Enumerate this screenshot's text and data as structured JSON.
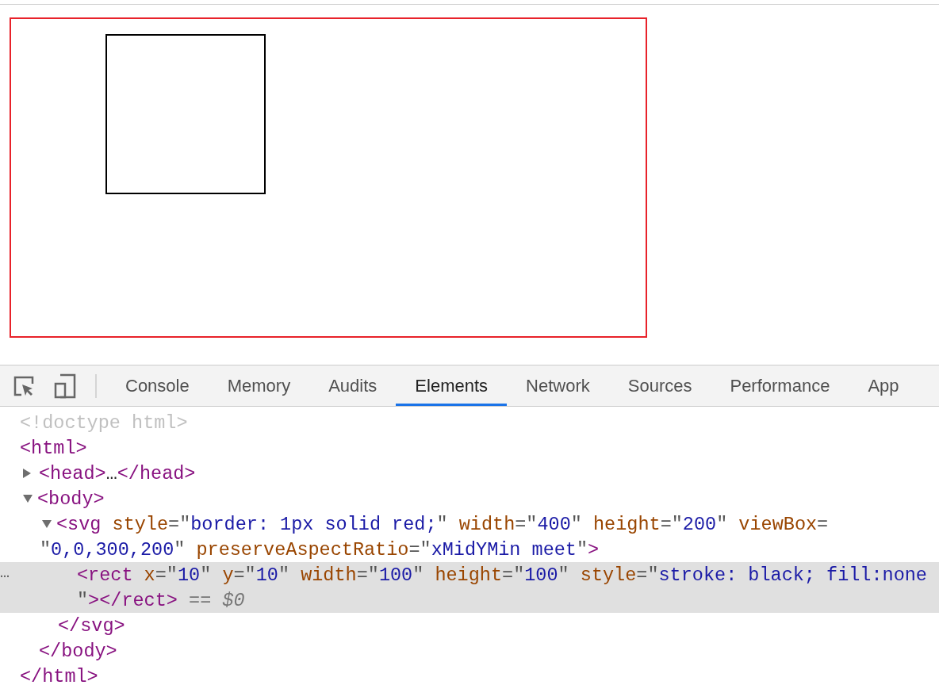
{
  "toolbar": {
    "tabs": [
      {
        "label": "Console",
        "selected": false
      },
      {
        "label": "Memory",
        "selected": false
      },
      {
        "label": "Audits",
        "selected": false
      },
      {
        "label": "Elements",
        "selected": true
      },
      {
        "label": "Network",
        "selected": false
      },
      {
        "label": "Sources",
        "selected": false
      },
      {
        "label": "Performance",
        "selected": false
      },
      {
        "label": "App",
        "selected": false
      }
    ]
  },
  "dom": [
    {
      "selected": false,
      "lines": [
        [
          {
            "kind": "doctype",
            "text": "<!doctype html>"
          }
        ]
      ]
    },
    {
      "selected": false,
      "lines": [
        [
          {
            "kind": "tag",
            "text": "<html>"
          }
        ]
      ],
      "close": [
        [
          {
            "kind": "tag",
            "text": "</html>"
          }
        ]
      ],
      "children": [
        {
          "selected": false,
          "expanded": false,
          "lines": [
            [
              {
                "kind": "tag",
                "text": "<head>"
              },
              {
                "kind": "text",
                "text": "…"
              },
              {
                "kind": "tag",
                "text": "</head>"
              }
            ]
          ]
        },
        {
          "selected": false,
          "expanded": true,
          "lines": [
            [
              {
                "kind": "tag",
                "text": "<body>"
              }
            ]
          ],
          "close": [
            [
              {
                "kind": "tag",
                "text": "</body>"
              }
            ]
          ],
          "children": [
            {
              "selected": false,
              "expanded": true,
              "lines": [
                [
                  {
                    "kind": "tag",
                    "text": "<svg"
                  },
                  {
                    "kind": "attr",
                    "text": " style"
                  },
                  {
                    "kind": "punct",
                    "text": "=\""
                  },
                  {
                    "kind": "value",
                    "text": "border: 1px solid red;"
                  },
                  {
                    "kind": "punct",
                    "text": "\""
                  },
                  {
                    "kind": "attr",
                    "text": " width"
                  },
                  {
                    "kind": "punct",
                    "text": "=\""
                  },
                  {
                    "kind": "value",
                    "text": "400"
                  },
                  {
                    "kind": "punct",
                    "text": "\""
                  },
                  {
                    "kind": "attr",
                    "text": " height"
                  },
                  {
                    "kind": "punct",
                    "text": "=\""
                  },
                  {
                    "kind": "value",
                    "text": "200"
                  },
                  {
                    "kind": "punct",
                    "text": "\""
                  },
                  {
                    "kind": "attr",
                    "text": " viewBox"
                  },
                  {
                    "kind": "punct",
                    "text": "="
                  }
                ],
                [
                  {
                    "kind": "punct",
                    "text": "\""
                  },
                  {
                    "kind": "value",
                    "text": "0,0,300,200"
                  },
                  {
                    "kind": "punct",
                    "text": "\""
                  },
                  {
                    "kind": "attr",
                    "text": " preserveAspectRatio"
                  },
                  {
                    "kind": "punct",
                    "text": "=\""
                  },
                  {
                    "kind": "value",
                    "text": "xMidYMin meet"
                  },
                  {
                    "kind": "punct",
                    "text": "\""
                  },
                  {
                    "kind": "tag",
                    "text": ">"
                  }
                ]
              ],
              "close": [
                [
                  {
                    "kind": "tag",
                    "text": "</svg>"
                  }
                ]
              ],
              "children": [
                {
                  "selected": true,
                  "gutter": "…",
                  "lines": [
                    [
                      {
                        "kind": "tag",
                        "text": "<rect"
                      },
                      {
                        "kind": "attr",
                        "text": " x"
                      },
                      {
                        "kind": "punct",
                        "text": "=\""
                      },
                      {
                        "kind": "value",
                        "text": "10"
                      },
                      {
                        "kind": "punct",
                        "text": "\""
                      },
                      {
                        "kind": "attr",
                        "text": " y"
                      },
                      {
                        "kind": "punct",
                        "text": "=\""
                      },
                      {
                        "kind": "value",
                        "text": "10"
                      },
                      {
                        "kind": "punct",
                        "text": "\""
                      },
                      {
                        "kind": "attr",
                        "text": " width"
                      },
                      {
                        "kind": "punct",
                        "text": "=\""
                      },
                      {
                        "kind": "value",
                        "text": "100"
                      },
                      {
                        "kind": "punct",
                        "text": "\""
                      },
                      {
                        "kind": "attr",
                        "text": " height"
                      },
                      {
                        "kind": "punct",
                        "text": "=\""
                      },
                      {
                        "kind": "value",
                        "text": "100"
                      },
                      {
                        "kind": "punct",
                        "text": "\""
                      },
                      {
                        "kind": "attr",
                        "text": " style"
                      },
                      {
                        "kind": "punct",
                        "text": "=\""
                      },
                      {
                        "kind": "value",
                        "text": "stroke: black; fill:none"
                      }
                    ],
                    [
                      {
                        "kind": "punct",
                        "text": "\""
                      },
                      {
                        "kind": "tag",
                        "text": "></rect>"
                      },
                      {
                        "kind": "hint",
                        "text": " == "
                      },
                      {
                        "kind": "hintvar",
                        "text": "$0"
                      }
                    ]
                  ]
                }
              ]
            }
          ]
        }
      ]
    }
  ]
}
